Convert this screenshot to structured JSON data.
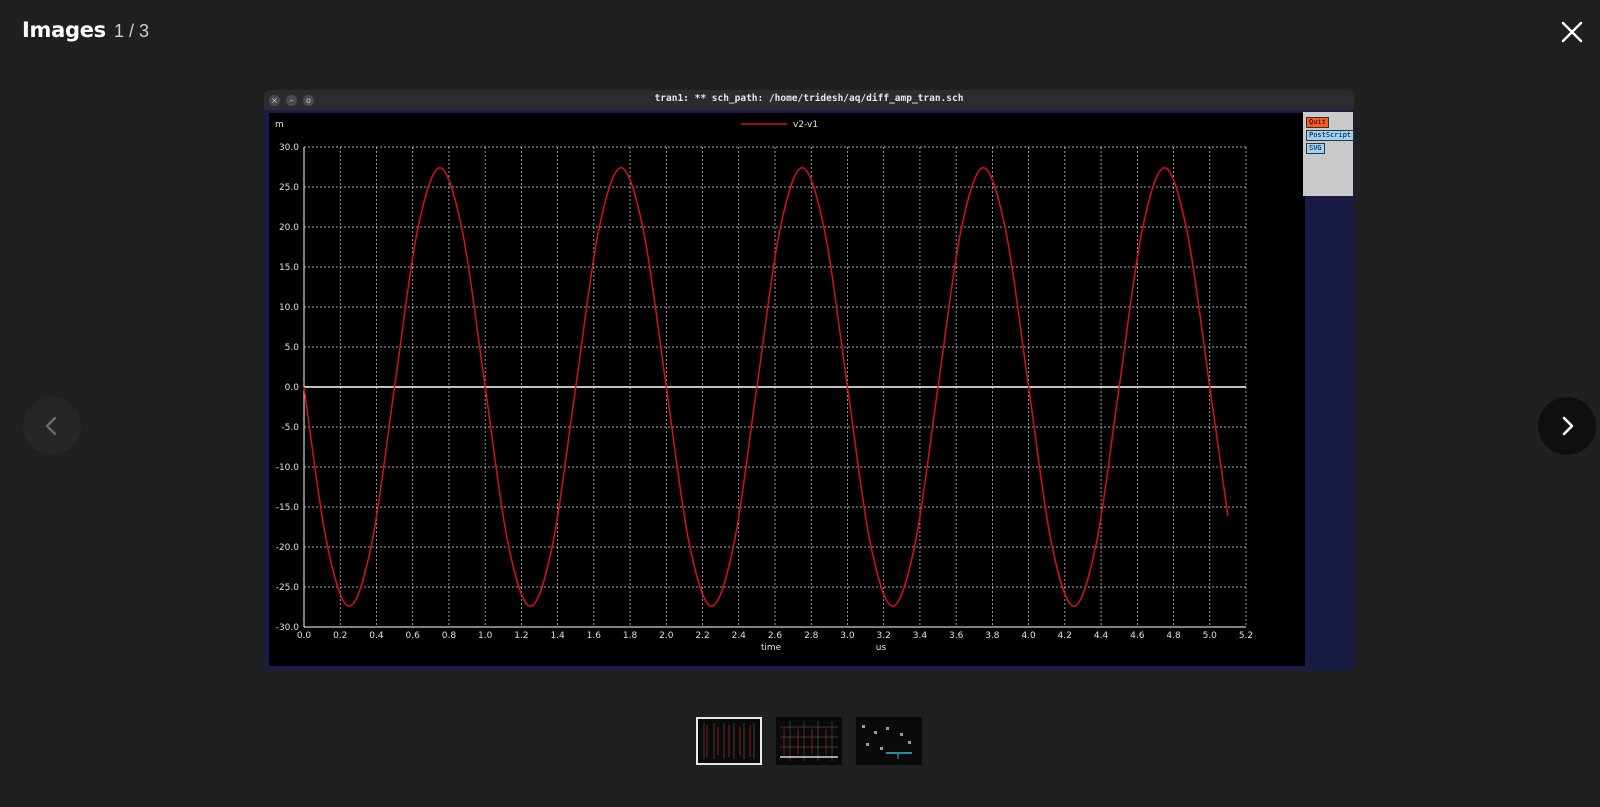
{
  "viewer": {
    "title": "Images",
    "counter": "1 / 3",
    "icons": {
      "close": "close-icon",
      "prev": "chevron-left-icon",
      "next": "chevron-right-icon"
    }
  },
  "screenshot": {
    "window_title": "tran1: ** sch_path: /home/tridesh/aq/diff_amp_tran.sch",
    "titlebar_buttons": [
      "×",
      "–",
      "o"
    ],
    "side_panel": {
      "quit": "Quit",
      "postscript": "PostScript",
      "svg": "SVG"
    }
  },
  "thumbnails": {
    "count": 3,
    "active_index": 0
  },
  "colors": {
    "plot_bg": "#000000",
    "grid": "#d8d8d8",
    "trace": "#d01515",
    "zero_line": "#ffffff",
    "axis_text": "#e0e0e0",
    "frame": "#1b1c45"
  },
  "chart_data": {
    "type": "line",
    "y_unit_label": "m",
    "xlabel": "time",
    "x_unit_label": "us",
    "xlim": [
      0.0,
      5.2
    ],
    "ylim": [
      -30.0,
      30.0
    ],
    "x_ticks": [
      "0.0",
      "0.2",
      "0.4",
      "0.6",
      "0.8",
      "1.0",
      "1.2",
      "1.4",
      "1.6",
      "1.8",
      "2.0",
      "2.2",
      "2.4",
      "2.6",
      "2.8",
      "3.0",
      "3.2",
      "3.4",
      "3.6",
      "3.8",
      "4.0",
      "4.2",
      "4.4",
      "4.6",
      "4.8",
      "5.0",
      "5.2"
    ],
    "y_ticks": [
      "30.0",
      "25.0",
      "20.0",
      "15.0",
      "10.0",
      "5.0",
      "0.0",
      "-5.0",
      "-10.0",
      "-15.0",
      "-20.0",
      "-25.0",
      "-30.0"
    ],
    "grid": true,
    "legend_position": "top-center",
    "series": [
      {
        "name": "v2-v1",
        "color": "#d01515",
        "x": [
          0.0,
          0.125,
          0.25,
          0.375,
          0.5,
          0.625,
          0.75,
          0.875,
          1.0,
          1.125,
          1.25,
          1.375,
          1.5,
          1.625,
          1.75,
          1.875,
          2.0,
          2.125,
          2.25,
          2.375,
          2.5,
          2.625,
          2.75,
          2.875,
          3.0,
          3.125,
          3.25,
          3.375,
          3.5,
          3.625,
          3.75,
          3.875,
          4.0,
          4.125,
          4.25,
          4.375,
          4.5,
          4.625,
          4.75,
          4.875,
          5.0,
          5.1
        ],
        "y": [
          0.0,
          -19.4,
          -27.4,
          -19.4,
          0.0,
          19.4,
          27.4,
          19.4,
          0.0,
          -19.4,
          -27.4,
          -19.4,
          0.0,
          19.4,
          27.4,
          19.4,
          0.0,
          -19.4,
          -27.4,
          -19.4,
          0.0,
          19.4,
          27.4,
          19.4,
          0.0,
          -19.4,
          -27.4,
          -19.4,
          0.0,
          19.4,
          27.4,
          19.4,
          0.0,
          -19.4,
          -27.4,
          -19.4,
          0.0,
          19.4,
          27.4,
          19.4,
          0.0,
          -16.1
        ]
      }
    ]
  }
}
